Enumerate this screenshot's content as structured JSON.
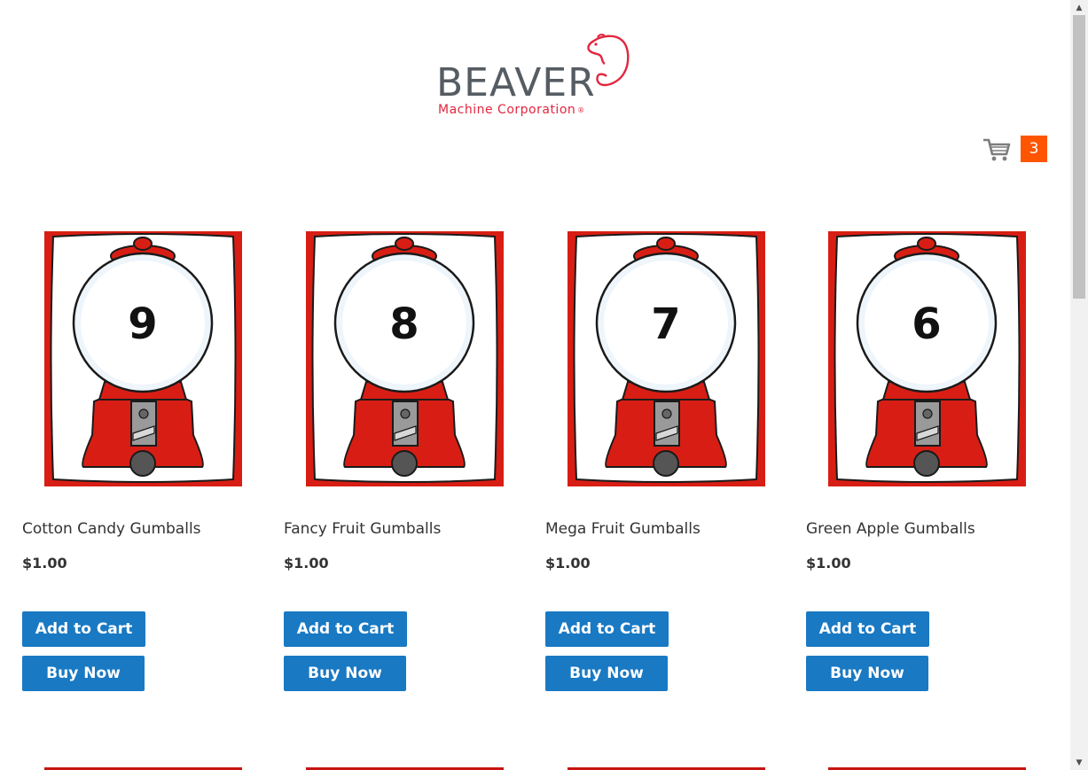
{
  "brand": {
    "name": "BEAVER",
    "subtitle": "Machine Corporation",
    "registered": "®",
    "accent_color": "#e2263f"
  },
  "cart": {
    "icon": "shopping-cart-icon",
    "count": "3",
    "badge_color": "#ff5501"
  },
  "products": [
    {
      "number": "9",
      "name": "Cotton Candy Gumballs",
      "price": "$1.00",
      "add_label": "Add to Cart",
      "buy_label": "Buy Now"
    },
    {
      "number": "8",
      "name": "Fancy Fruit Gumballs",
      "price": "$1.00",
      "add_label": "Add to Cart",
      "buy_label": "Buy Now"
    },
    {
      "number": "7",
      "name": "Mega Fruit Gumballs",
      "price": "$1.00",
      "add_label": "Add to Cart",
      "buy_label": "Buy Now"
    },
    {
      "number": "6",
      "name": "Green Apple Gumballs",
      "price": "$1.00",
      "add_label": "Add to Cart",
      "buy_label": "Buy Now"
    }
  ],
  "colors": {
    "button": "#1979c3",
    "machine_red": "#d81e14"
  },
  "scrollbar": {
    "up_icon": "arrow-up-icon",
    "down_icon": "arrow-down-icon"
  }
}
